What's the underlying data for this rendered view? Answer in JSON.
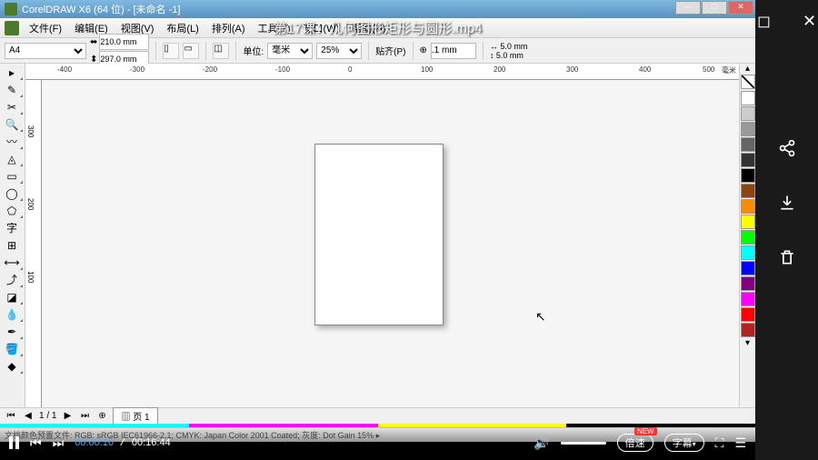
{
  "video_title": "第17课：几何图形矩形与圆形.mp4",
  "window": {
    "title": "CorelDRAW X6 (64 位) - [未命名 -1]"
  },
  "menu": {
    "file": "文件(F)",
    "edit": "编辑(E)",
    "view": "视图(V)",
    "layout": "布局(L)",
    "arrange": "排列(A)",
    "tools": "工具(T)",
    "window": "窗口(W)",
    "help": "帮助(H)"
  },
  "prop": {
    "paper": "A4",
    "width": "210.0 mm",
    "height": "297.0 mm",
    "units_label": "单位:",
    "units": "毫米",
    "zoom": "25%",
    "snap": "贴齐(P)",
    "nudge": ".1 mm",
    "dup_x": "5.0 mm",
    "dup_y": "5.0 mm"
  },
  "ruler": {
    "h": [
      "-400",
      "-300",
      "-200",
      "-100",
      "0",
      "100",
      "200",
      "300",
      "400",
      "500"
    ],
    "hunit": "毫米",
    "v": [
      "300",
      "200",
      "100"
    ]
  },
  "page": {
    "nav": "1 / 1",
    "tab": "页 1"
  },
  "status": "文档颜色预置文件: RGB: sRGB IEC61966-2.1; CMYK: Japan Color 2001 Coated; 灰度: Dot Gain 15% ▸",
  "player": {
    "cur": "00:00:16",
    "dur": "00:16:44",
    "speed": "倍速",
    "speed_badge": "NEW",
    "caption": "字幕"
  },
  "palette": [
    "#fff",
    "#ccc",
    "#999",
    "#666",
    "#333",
    "#000",
    "#8b4513",
    "#ff8c00",
    "#ffff00",
    "#00ff00",
    "#00ffff",
    "#0000ff",
    "#800080",
    "#ff00ff",
    "#ff0000",
    "#b22222"
  ],
  "colorbar": [
    "#00ffff",
    "#ff00ff",
    "#ffff00",
    "#000000"
  ]
}
